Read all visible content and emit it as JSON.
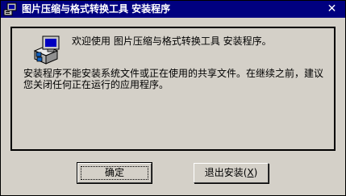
{
  "titlebar": {
    "icon": "setup-computer-icon",
    "title": "图片压缩与格式转换工具 安装程序",
    "close_glyph": "✕",
    "bg_color": "#000080"
  },
  "content": {
    "icon": "setup-computer-icon",
    "welcome": "欢迎使用 图片压缩与格式转换工具 安装程序。",
    "warning": "安装程序不能安装系统文件或正在使用的共享文件。在继续之前，建议您关闭任何正在运行的应用程序。"
  },
  "buttons": {
    "ok_label": "确定",
    "cancel_prefix": "退出安装(",
    "cancel_mnemonic": "X",
    "cancel_suffix": ")"
  },
  "colors": {
    "face": "#d4d0c8",
    "title_bg": "#000080"
  }
}
